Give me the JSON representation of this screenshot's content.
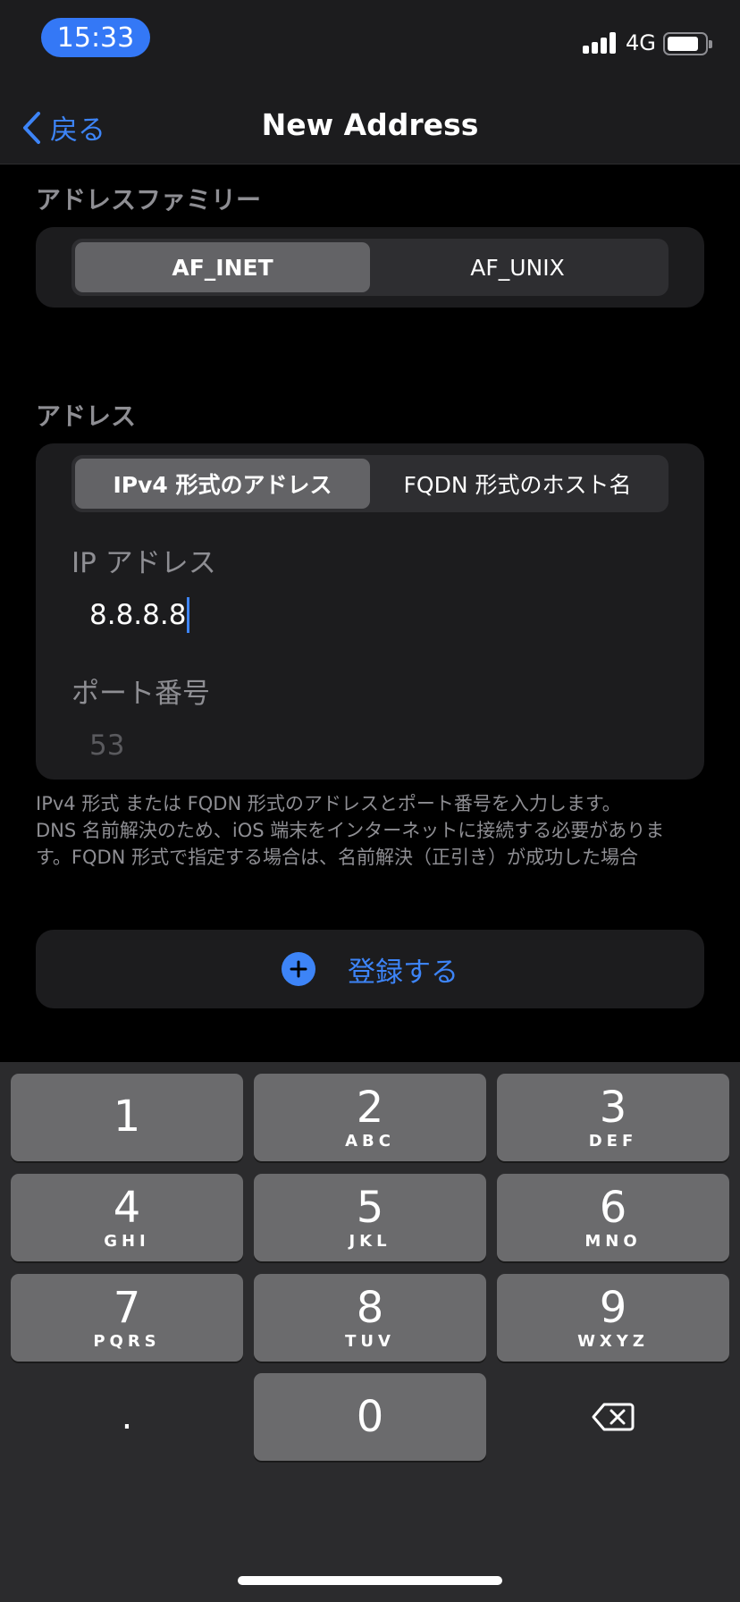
{
  "status_bar": {
    "time": "15:33",
    "network": "4G",
    "battery_level": 0.8
  },
  "nav": {
    "back_label": "戻る",
    "title": "New Address"
  },
  "family_section": {
    "header": "アドレスファミリー",
    "options": [
      "AF_INET",
      "AF_UNIX"
    ],
    "selected": "AF_INET"
  },
  "address_section": {
    "header": "アドレス",
    "formats": [
      "IPv4 形式のアドレス",
      "FQDN 形式のホスト名"
    ],
    "selected": "IPv4 形式のアドレス",
    "ip_label": "IP アドレス",
    "ip_value": "8.8.8.8",
    "port_label": "ポート番号",
    "port_placeholder": "53"
  },
  "footnote": {
    "line1": "IPv4 形式 または FQDN 形式のアドレスとポート番号を入力します。",
    "line2": "DNS 名前解決のため、iOS 端末をインターネットに接続する必要がありま",
    "line3": "す。FQDN 形式で指定する場合は、名前解決（正引き）が成功した場合"
  },
  "register_button": {
    "label": "登録する",
    "icon": "plus-circle-icon"
  },
  "keypad": {
    "keys": [
      {
        "num": "1",
        "letters": ""
      },
      {
        "num": "2",
        "letters": "ABC"
      },
      {
        "num": "3",
        "letters": "DEF"
      },
      {
        "num": "4",
        "letters": "GHI"
      },
      {
        "num": "5",
        "letters": "JKL"
      },
      {
        "num": "6",
        "letters": "MNO"
      },
      {
        "num": "7",
        "letters": "PQRS"
      },
      {
        "num": "8",
        "letters": "TUV"
      },
      {
        "num": "9",
        "letters": "WXYZ"
      }
    ],
    "dot": ".",
    "zero": "0",
    "delete_icon": "delete-backspace-icon"
  },
  "colors": {
    "accent": "#3d84f7",
    "card": "#1c1c1e",
    "key": "#6b6b6d",
    "keyboard": "#2b2b2d"
  }
}
